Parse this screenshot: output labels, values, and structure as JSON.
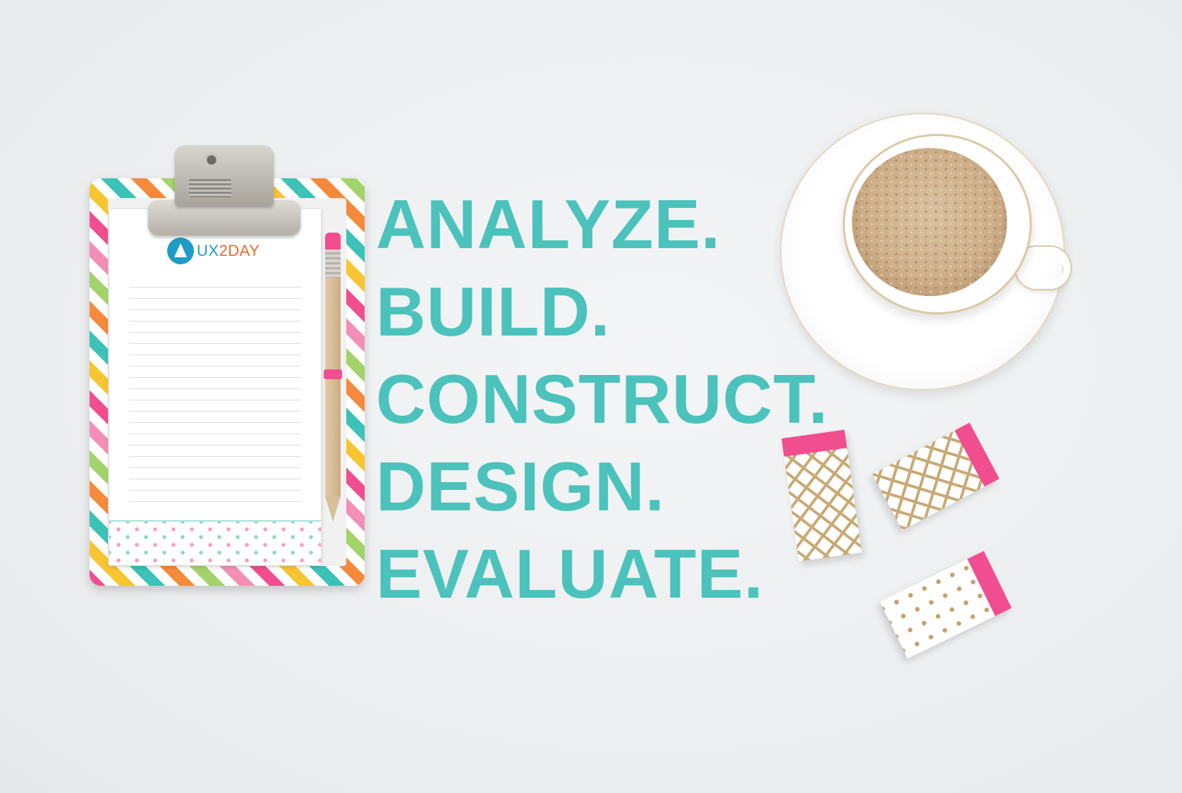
{
  "logo": {
    "brand_ux": "UX",
    "brand_2day": "2DAY"
  },
  "headline": {
    "lines": [
      "ANALYZE.",
      "BUILD.",
      "CONSTRUCT.",
      "DESIGN.",
      "EVALUATE."
    ]
  },
  "colors": {
    "headline": "#4cc2bc",
    "logo_blue": "#1f9bc8",
    "logo_orange": "#ee6a2e",
    "accent_pink": "#f04e8f"
  },
  "icons": [
    "clipboard-icon",
    "pencil-icon",
    "coffee-cup-icon",
    "eraser-icon"
  ]
}
